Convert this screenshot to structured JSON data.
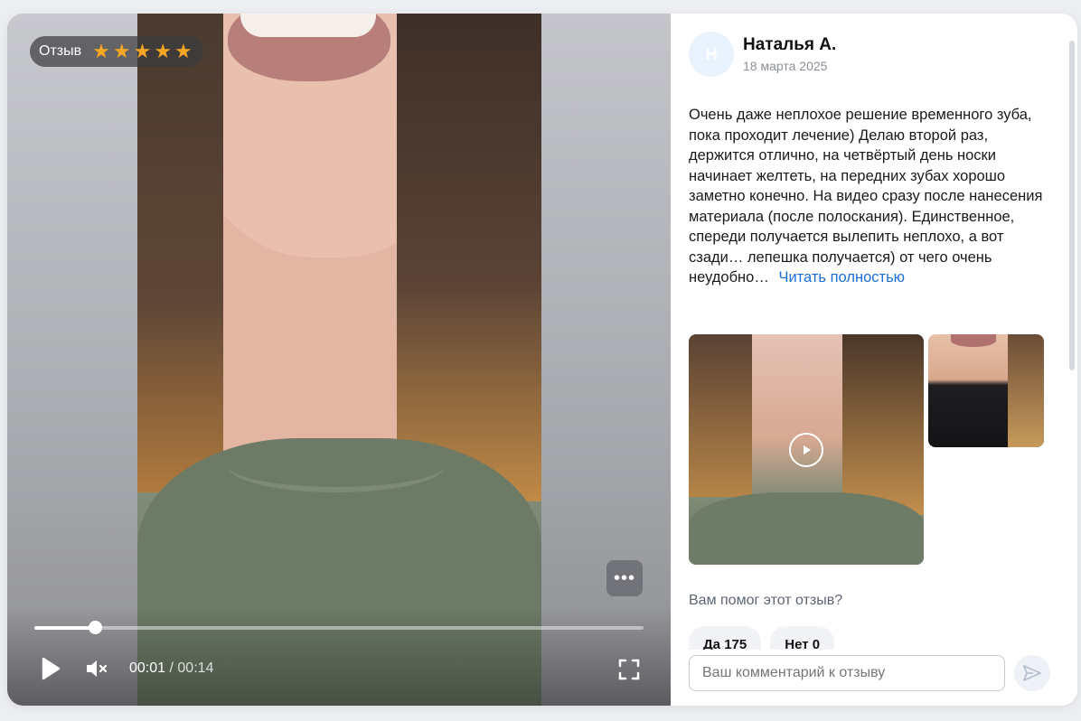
{
  "player": {
    "badge_label": "Отзыв",
    "rating": 5,
    "rating_max": 5,
    "star_color": "#f5a623",
    "time_current": "00:01",
    "time_total": "/ 00:14",
    "progress": 0.1,
    "muted": true,
    "more_icon": "ellipsis-icon"
  },
  "review": {
    "avatar_letter": "Н",
    "author": "Наталья А.",
    "date": "18 марта 2025",
    "text": "Очень даже неплохое решение временного зуба, пока проходит лечение) Делаю второй раз, держится отлично, на четвёртый день носки начинает желтеть, на передних зубах хорошо заметно конечно. На видео сразу после нанесения материала (после полоскания). Единственное, спереди получается вылепить неплохо, а вот сзади… лепешка получается) от чего очень неудобно…",
    "read_more": "Читать полностью",
    "link_color": "#1a6fd6"
  },
  "feedback": {
    "question": "Вам помог этот отзыв?",
    "yes_label": "Да 175",
    "no_label": "Нет 0"
  },
  "comment": {
    "placeholder": "Ваш комментарий к отзыву"
  }
}
